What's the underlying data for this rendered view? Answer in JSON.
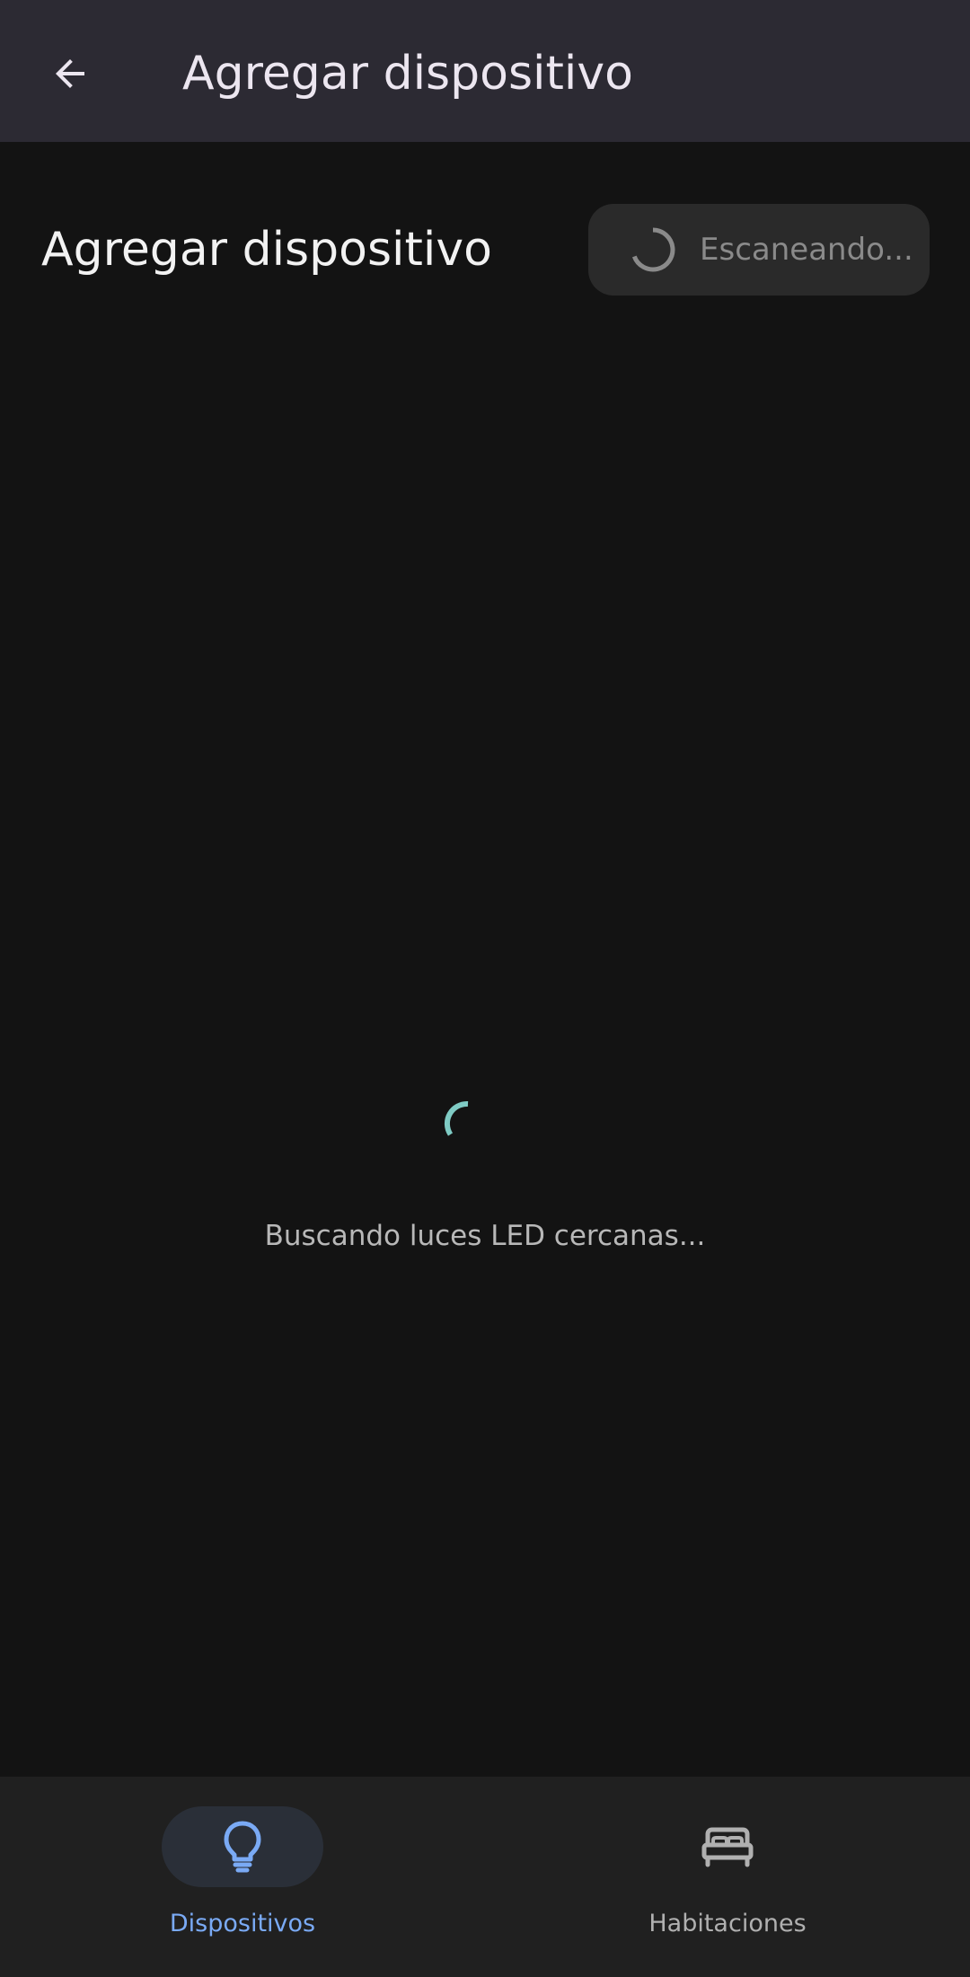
{
  "app_bar": {
    "title": "Agregar dispositivo",
    "back_icon": "arrow-back-icon"
  },
  "main": {
    "section_title": "Agregar dispositivo",
    "scan_button": {
      "label": "Escaneando...",
      "icon": "spinner-icon",
      "state": "scanning"
    },
    "status_text": "Buscando luces LED cercanas...",
    "spinner_icon": "loading-spinner-icon"
  },
  "bottom_nav": {
    "items": [
      {
        "label": "Dispositivos",
        "icon": "lightbulb-icon",
        "active": true
      },
      {
        "label": "Habitaciones",
        "icon": "bed-icon",
        "active": false
      }
    ]
  },
  "colors": {
    "app_bar_bg": "#2c2a33",
    "background": "#131313",
    "nav_bg": "#202020",
    "accent": "#7aaaf5",
    "spinner": "#7fcbc4",
    "inactive_nav": "#b0b0b0"
  }
}
